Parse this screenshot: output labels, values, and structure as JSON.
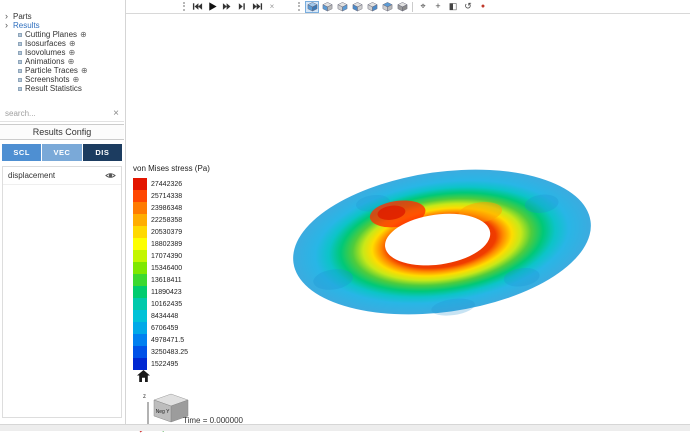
{
  "topbar": {
    "playback_buttons": [
      {
        "name": "skip-to-start-button",
        "icon": "skip-start"
      },
      {
        "name": "play-button",
        "icon": "play"
      },
      {
        "name": "fast-forward-button",
        "icon": "fast-forward"
      },
      {
        "name": "step-forward-button",
        "icon": "step-forward"
      },
      {
        "name": "skip-to-end-button",
        "icon": "skip-end"
      },
      {
        "name": "close-playback-toolbar-button",
        "icon": "close"
      }
    ],
    "view_buttons": [
      {
        "name": "iso-view-button",
        "icon": "cube-iso",
        "active": true
      },
      {
        "name": "front-view-button",
        "icon": "cube-front"
      },
      {
        "name": "back-view-button",
        "icon": "cube-back"
      },
      {
        "name": "left-view-button",
        "icon": "cube-left"
      },
      {
        "name": "right-view-button",
        "icon": "cube-right"
      },
      {
        "name": "top-view-button",
        "icon": "cube-top"
      },
      {
        "name": "bottom-view-button",
        "icon": "cube-bottom"
      },
      {
        "separator": true
      },
      {
        "name": "fit-view-button",
        "icon": "fit"
      },
      {
        "name": "center-view-button",
        "icon": "center"
      },
      {
        "name": "clip-plane-button",
        "icon": "clip"
      },
      {
        "name": "reset-rotation-button",
        "icon": "rotate"
      },
      {
        "name": "record-button",
        "icon": "record"
      }
    ]
  },
  "sidebar": {
    "tree": [
      {
        "label": "Parts",
        "level": 0,
        "arrow": "›"
      },
      {
        "label": "Results",
        "level": 0,
        "arrow": "›",
        "active": true
      },
      {
        "label": "Cutting Planes",
        "level": 1,
        "add": "⊕"
      },
      {
        "label": "Isosurfaces",
        "level": 1,
        "add": "⊕"
      },
      {
        "label": "Isovolumes",
        "level": 1,
        "add": "⊕"
      },
      {
        "label": "Animations",
        "level": 1,
        "add": "⊕"
      },
      {
        "label": "Particle Traces",
        "level": 1,
        "add": "⊕"
      },
      {
        "label": "Screenshots",
        "level": 1,
        "add": "⊕"
      },
      {
        "label": "Result Statistics",
        "level": 1
      }
    ],
    "search_placeholder": "search...",
    "clear_icon": "×",
    "config_title": "Results Config",
    "tabs": [
      {
        "label": "SCL",
        "color": "#4e8fd2"
      },
      {
        "label": "VEC",
        "color": "#7aa9d8"
      },
      {
        "label": "DIS",
        "color": "#1c3c60",
        "active": true
      }
    ],
    "fields": [
      {
        "label": "displacement"
      }
    ]
  },
  "legend": {
    "title": "von Mises stress (Pa)",
    "entries": [
      {
        "label": "27442326",
        "color": "#e31500"
      },
      {
        "label": "25714338",
        "color": "#ff4600"
      },
      {
        "label": "23986348",
        "color": "#ff7b00"
      },
      {
        "label": "22258358",
        "color": "#ffad00"
      },
      {
        "label": "20530379",
        "color": "#ffd900"
      },
      {
        "label": "18802389",
        "color": "#fdff00"
      },
      {
        "label": "17074390",
        "color": "#c3f600"
      },
      {
        "label": "15346400",
        "color": "#7ee800"
      },
      {
        "label": "13618411",
        "color": "#3bd930"
      },
      {
        "label": "11890423",
        "color": "#00cc6e"
      },
      {
        "label": "10162435",
        "color": "#00c9ab"
      },
      {
        "label": "8434448",
        "color": "#00c2d8"
      },
      {
        "label": "6706459",
        "color": "#00a9e8"
      },
      {
        "label": "4978471.5",
        "color": "#0080f0"
      },
      {
        "label": "3250483.25",
        "color": "#0052e8"
      },
      {
        "label": "1522495",
        "color": "#0028d2"
      }
    ]
  },
  "viewport": {
    "time_label": "Time = 0.000000",
    "nav_cube": {
      "face_label": "Neg Y",
      "axis_label": "z"
    }
  }
}
